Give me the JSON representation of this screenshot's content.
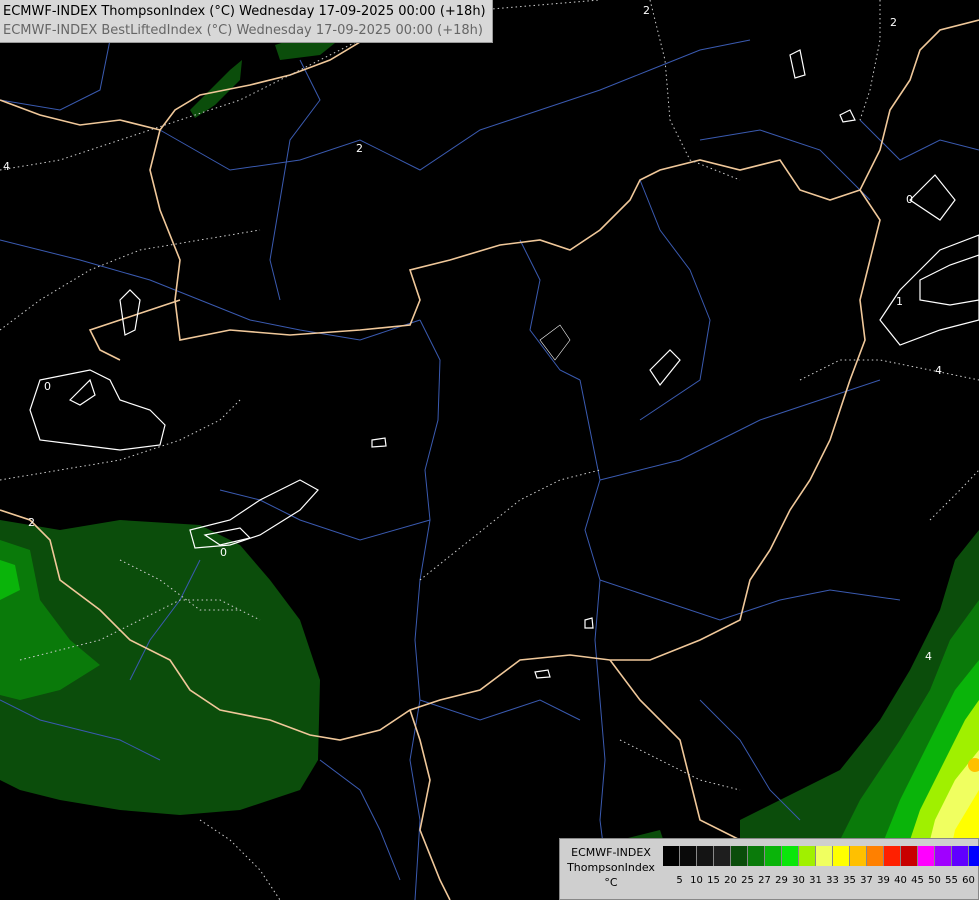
{
  "header": {
    "line1": "ECMWF-INDEX ThompsonIndex (°C) Wednesday 17-09-2025 00:00 (+18h)",
    "line2": "ECMWF-INDEX BestLiftedIndex (°C) Wednesday 17-09-2025 00:00 (+18h)"
  },
  "legend": {
    "title1": "ECMWF-INDEX",
    "title2": "ThompsonIndex",
    "unit": "°C",
    "ticks": [
      "5",
      "10",
      "15",
      "20",
      "25",
      "27",
      "29",
      "30",
      "31",
      "33",
      "35",
      "37",
      "39",
      "40",
      "45",
      "50",
      "55",
      "60"
    ],
    "colors": [
      "#000000",
      "#0a0a0a",
      "#141414",
      "#1e1e1e",
      "#0b4d0b",
      "#0a7a0a",
      "#0ab40a",
      "#0ae60a",
      "#a0f000",
      "#f0ff60",
      "#ffff00",
      "#ffc000",
      "#ff8000",
      "#ff2000",
      "#c80000",
      "#ff00ff",
      "#a000ff",
      "#6000ff",
      "#0000ff"
    ]
  },
  "contour_labels": [
    {
      "text": "2",
      "key": "c1"
    },
    {
      "text": "2",
      "key": "c2"
    },
    {
      "text": "2",
      "key": "c3"
    },
    {
      "text": "4",
      "key": "c4"
    },
    {
      "text": "0",
      "key": "c5"
    },
    {
      "text": "2",
      "key": "c6"
    },
    {
      "text": "0",
      "key": "c7"
    },
    {
      "text": "0",
      "key": "c8"
    },
    {
      "text": "1",
      "key": "c9"
    },
    {
      "text": "4",
      "key": "c10"
    },
    {
      "text": "4",
      "key": "c11"
    }
  ]
}
